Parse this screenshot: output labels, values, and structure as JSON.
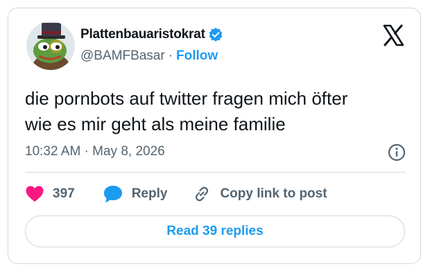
{
  "author": {
    "display_name": "Plattenbauaristokrat",
    "handle": "@BAMFBasar",
    "separator": "·",
    "follow_label": "Follow",
    "verified": true
  },
  "tweet": {
    "text_line1": "die pornbots auf twitter fragen mich öfter",
    "text_line2": "wie es mir geht als meine familie",
    "timestamp": "10:32 AM · May 8, 2026"
  },
  "actions": {
    "like_count": "397",
    "reply_label": "Reply",
    "copy_label": "Copy link to post"
  },
  "footer": {
    "read_replies_label": "Read 39 replies"
  },
  "icons": {
    "logo": "x-logo-icon",
    "verified": "verified-badge-icon",
    "info": "info-icon",
    "like": "heart-icon",
    "reply": "speech-bubble-icon",
    "copy": "link-icon"
  },
  "colors": {
    "accent": "#1d9bf0",
    "heart": "#f91880",
    "text": "#0f1419",
    "muted": "#536471",
    "border": "#cfd9de"
  }
}
